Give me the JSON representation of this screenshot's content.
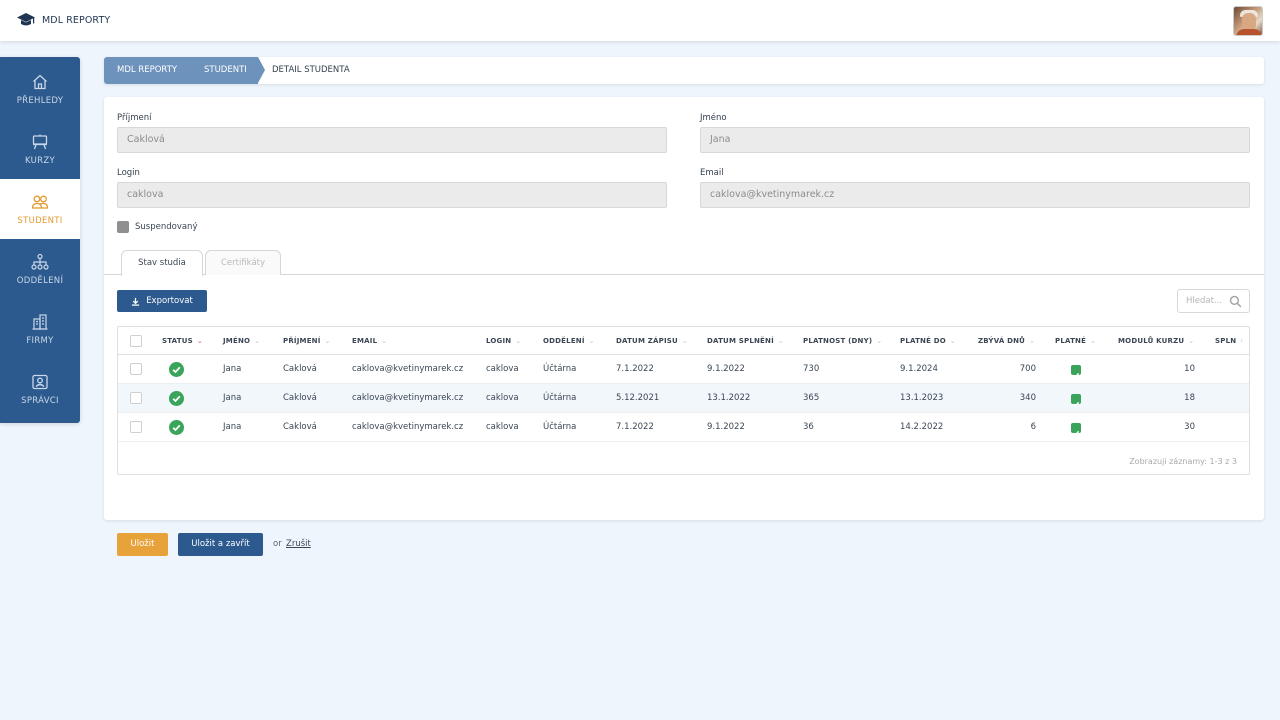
{
  "app": {
    "title": "MDL REPORTY"
  },
  "sidebar": {
    "items": [
      {
        "label": "PŘEHLEDY",
        "icon": "home-icon"
      },
      {
        "label": "KURZY",
        "icon": "presentation-board-icon"
      },
      {
        "label": "STUDENTI",
        "icon": "users-icon"
      },
      {
        "label": "ODDĚLENÍ",
        "icon": "org-chart-icon"
      },
      {
        "label": "FIRMY",
        "icon": "buildings-icon"
      },
      {
        "label": "SPRÁVCI",
        "icon": "admin-portrait-icon"
      }
    ],
    "active_index": 2
  },
  "breadcrumb": {
    "items": [
      "MDL REPORTY",
      "STUDENTI",
      "DETAIL STUDENTA"
    ]
  },
  "form": {
    "surname": {
      "label": "Příjmení",
      "value": "Caklová"
    },
    "firstname": {
      "label": "Jméno",
      "value": "Jana"
    },
    "login": {
      "label": "Login",
      "value": "caklova"
    },
    "email": {
      "label": "Email",
      "value": "caklova@kvetinymarek.cz"
    },
    "suspended": {
      "label": "Suspendovaný",
      "checked": false
    }
  },
  "tabs": [
    {
      "label": "Stav studia",
      "active": true
    },
    {
      "label": "Certifikáty",
      "active": false
    }
  ],
  "toolbar": {
    "export_label": "Exportovat",
    "search_placeholder": "Hledat..."
  },
  "table": {
    "columns": [
      "STATUS",
      "JMÉNO",
      "PŘÍJMENÍ",
      "EMAIL",
      "LOGIN",
      "ODDĚLENÍ",
      "DATUM ZÁPISU",
      "DATUM SPLNĚNÍ",
      "PLATNOST (DNY)",
      "PLATNÉ DO",
      "ZBÝVÁ DNŮ",
      "PLATNÉ",
      "MODULŮ KURZU",
      "SPLN"
    ],
    "rows": [
      {
        "jmeno": "Jana",
        "prijmeni": "Caklová",
        "email": "caklova@kvetinymarek.cz",
        "login": "caklova",
        "oddeleni": "Účtárna",
        "datum_zapisu": "7.1.2022",
        "datum_splneni": "9.1.2022",
        "platnost": "730",
        "platne_do": "9.1.2024",
        "zbyva": "700",
        "moduly": "10"
      },
      {
        "jmeno": "Jana",
        "prijmeni": "Caklová",
        "email": "caklova@kvetinymarek.cz",
        "login": "caklova",
        "oddeleni": "Účtárna",
        "datum_zapisu": "5.12.2021",
        "datum_splneni": "13.1.2022",
        "platnost": "365",
        "platne_do": "13.1.2023",
        "zbyva": "340",
        "moduly": "18"
      },
      {
        "jmeno": "Jana",
        "prijmeni": "Caklová",
        "email": "caklova@kvetinymarek.cz",
        "login": "caklova",
        "oddeleni": "Účtárna",
        "datum_zapisu": "7.1.2022",
        "datum_splneni": "9.1.2022",
        "platnost": "36",
        "platne_do": "14.2.2022",
        "zbyva": "6",
        "moduly": "30"
      }
    ],
    "footer": "Zobrazuji záznamy: 1-3 z 3"
  },
  "actions": {
    "save": "Uložit",
    "save_close": "Uložit a zavřít",
    "or": "or",
    "cancel": "Zrušit"
  },
  "colors": {
    "primary": "#2d5a8e",
    "accent": "#e39b2f",
    "success": "#3aa55a",
    "background": "#eef5fc"
  }
}
